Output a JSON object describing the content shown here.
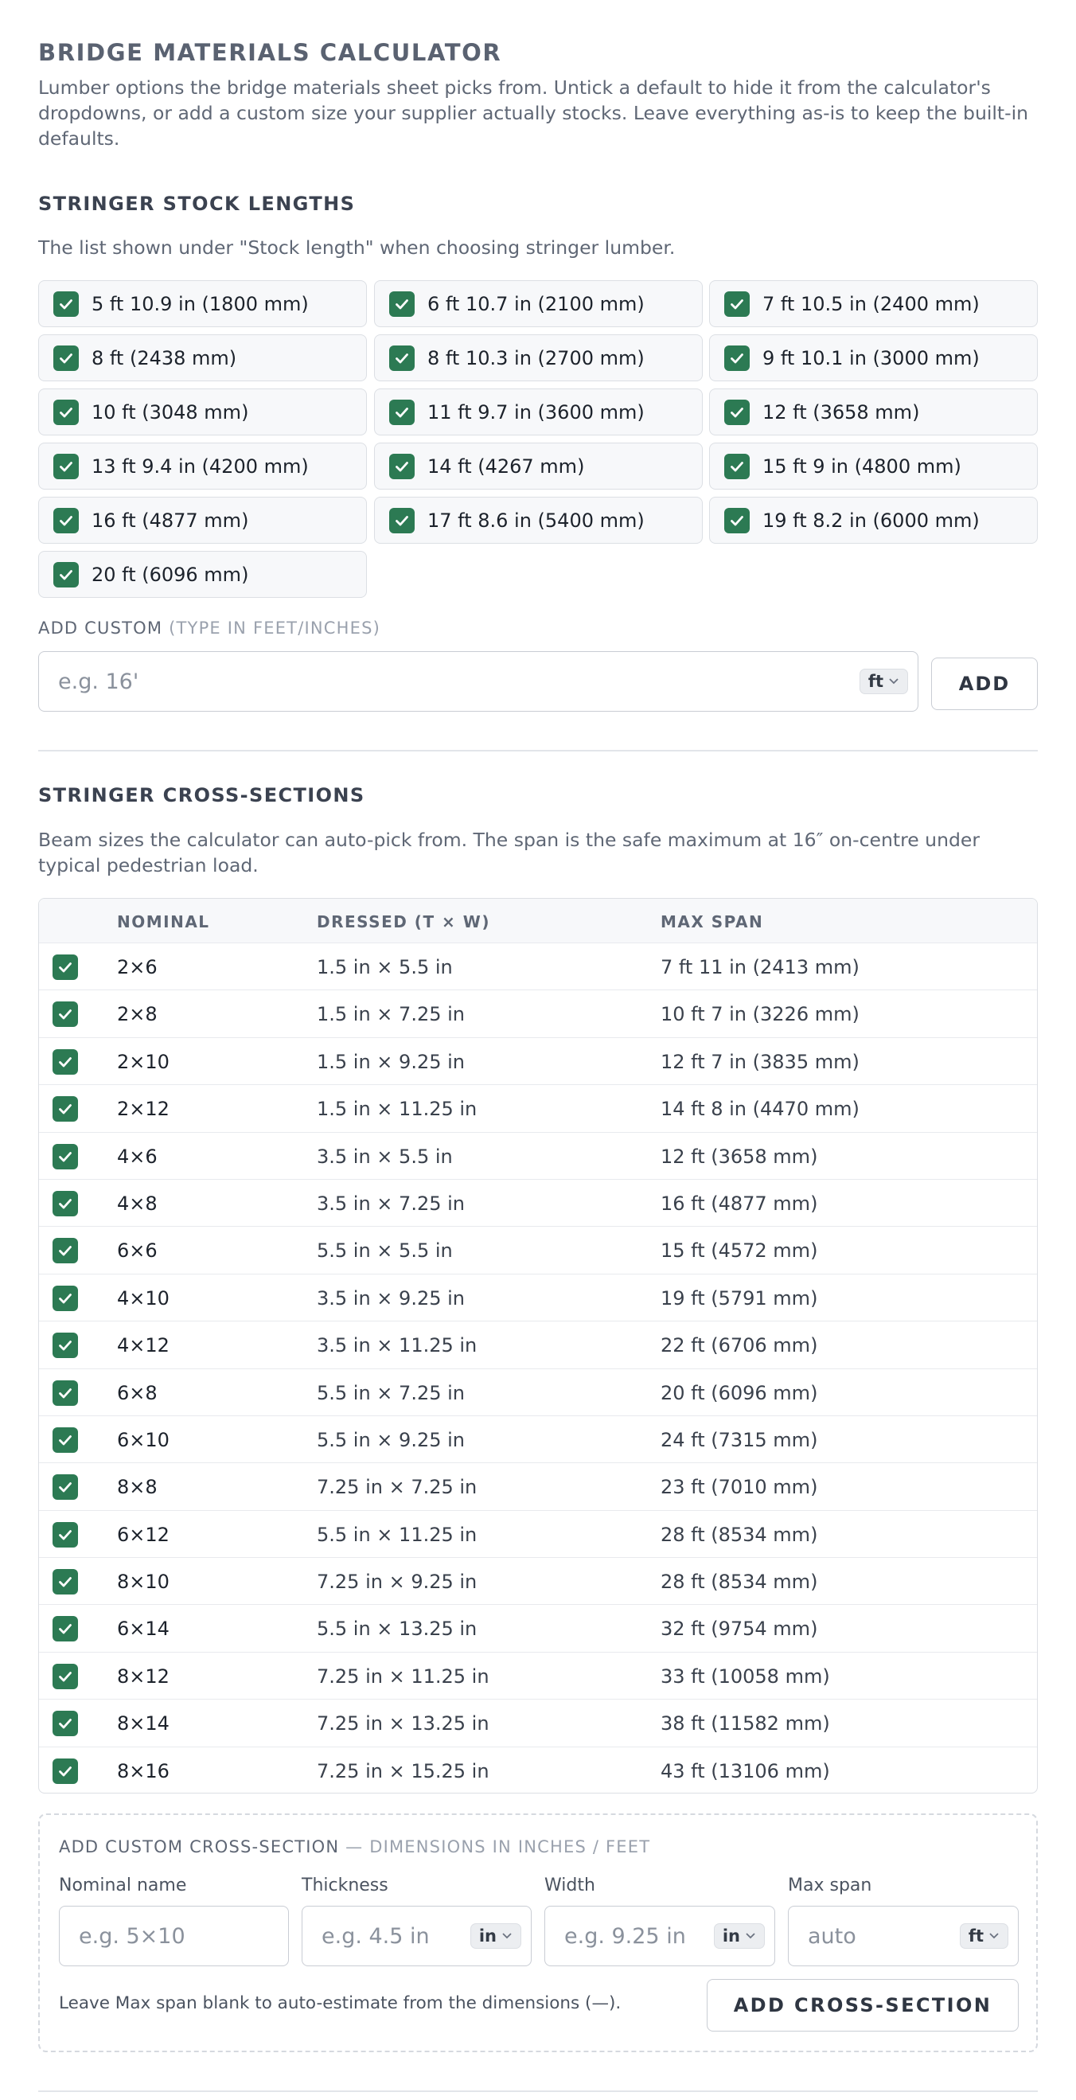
{
  "header": {
    "title": "BRIDGE MATERIALS CALCULATOR",
    "intro": "Lumber options the bridge materials sheet picks from. Untick a default to hide it from the calculator's dropdowns, or add a custom size your supplier actually stocks. Leave everything as-is to keep the built-in defaults."
  },
  "stock_lengths": {
    "title": "STRINGER STOCK LENGTHS",
    "description": "The list shown under \"Stock length\" when choosing stringer lumber.",
    "items": [
      {
        "label": "5 ft 10.9 in (1800 mm)",
        "checked": true
      },
      {
        "label": "6 ft 10.7 in (2100 mm)",
        "checked": true
      },
      {
        "label": "7 ft 10.5 in (2400 mm)",
        "checked": true
      },
      {
        "label": "8 ft (2438 mm)",
        "checked": true
      },
      {
        "label": "8 ft 10.3 in (2700 mm)",
        "checked": true
      },
      {
        "label": "9 ft 10.1 in (3000 mm)",
        "checked": true
      },
      {
        "label": "10 ft (3048 mm)",
        "checked": true
      },
      {
        "label": "11 ft 9.7 in (3600 mm)",
        "checked": true
      },
      {
        "label": "12 ft (3658 mm)",
        "checked": true
      },
      {
        "label": "13 ft 9.4 in (4200 mm)",
        "checked": true
      },
      {
        "label": "14 ft (4267 mm)",
        "checked": true
      },
      {
        "label": "15 ft 9 in (4800 mm)",
        "checked": true
      },
      {
        "label": "16 ft (4877 mm)",
        "checked": true
      },
      {
        "label": "17 ft 8.6 in (5400 mm)",
        "checked": true
      },
      {
        "label": "19 ft 8.2 in (6000 mm)",
        "checked": true
      },
      {
        "label": "20 ft (6096 mm)",
        "checked": true
      }
    ],
    "add_custom_label": "ADD CUSTOM",
    "add_custom_hint": "(TYPE IN FEET/INCHES)",
    "input_placeholder": "e.g. 16'",
    "unit": "ft",
    "add_button": "ADD"
  },
  "cross_sections": {
    "title": "STRINGER CROSS-SECTIONS",
    "description": "Beam sizes the calculator can auto-pick from. The span is the safe maximum at 16″ on-centre under typical pedestrian load.",
    "columns": {
      "nominal": "NOMINAL",
      "dressed": "DRESSED (T × W)",
      "span": "MAX SPAN"
    },
    "rows": [
      {
        "nominal": "2×6",
        "dressed": "1.5 in × 5.5 in",
        "span": "7 ft 11 in (2413 mm)",
        "checked": true
      },
      {
        "nominal": "2×8",
        "dressed": "1.5 in × 7.25 in",
        "span": "10 ft 7 in (3226 mm)",
        "checked": true
      },
      {
        "nominal": "2×10",
        "dressed": "1.5 in × 9.25 in",
        "span": "12 ft 7 in (3835 mm)",
        "checked": true
      },
      {
        "nominal": "2×12",
        "dressed": "1.5 in × 11.25 in",
        "span": "14 ft 8 in (4470 mm)",
        "checked": true
      },
      {
        "nominal": "4×6",
        "dressed": "3.5 in × 5.5 in",
        "span": "12 ft (3658 mm)",
        "checked": true
      },
      {
        "nominal": "4×8",
        "dressed": "3.5 in × 7.25 in",
        "span": "16 ft (4877 mm)",
        "checked": true
      },
      {
        "nominal": "6×6",
        "dressed": "5.5 in × 5.5 in",
        "span": "15 ft (4572 mm)",
        "checked": true
      },
      {
        "nominal": "4×10",
        "dressed": "3.5 in × 9.25 in",
        "span": "19 ft (5791 mm)",
        "checked": true
      },
      {
        "nominal": "4×12",
        "dressed": "3.5 in × 11.25 in",
        "span": "22 ft (6706 mm)",
        "checked": true
      },
      {
        "nominal": "6×8",
        "dressed": "5.5 in × 7.25 in",
        "span": "20 ft (6096 mm)",
        "checked": true
      },
      {
        "nominal": "6×10",
        "dressed": "5.5 in × 9.25 in",
        "span": "24 ft (7315 mm)",
        "checked": true
      },
      {
        "nominal": "8×8",
        "dressed": "7.25 in × 7.25 in",
        "span": "23 ft (7010 mm)",
        "checked": true
      },
      {
        "nominal": "6×12",
        "dressed": "5.5 in × 11.25 in",
        "span": "28 ft (8534 mm)",
        "checked": true
      },
      {
        "nominal": "8×10",
        "dressed": "7.25 in × 9.25 in",
        "span": "28 ft (8534 mm)",
        "checked": true
      },
      {
        "nominal": "6×14",
        "dressed": "5.5 in × 13.25 in",
        "span": "32 ft (9754 mm)",
        "checked": true
      },
      {
        "nominal": "8×12",
        "dressed": "7.25 in × 11.25 in",
        "span": "33 ft (10058 mm)",
        "checked": true
      },
      {
        "nominal": "8×14",
        "dressed": "7.25 in × 13.25 in",
        "span": "38 ft (11582 mm)",
        "checked": true
      },
      {
        "nominal": "8×16",
        "dressed": "7.25 in × 15.25 in",
        "span": "43 ft (13106 mm)",
        "checked": true
      }
    ]
  },
  "custom_cross_section": {
    "heading": "ADD CUSTOM CROSS-SECTION",
    "heading_hint": "— DIMENSIONS IN INCHES / FEET",
    "fields": {
      "nominal": {
        "label": "Nominal name",
        "placeholder": "e.g. 5×10"
      },
      "thickness": {
        "label": "Thickness",
        "placeholder": "e.g. 4.5 in",
        "unit": "in"
      },
      "width": {
        "label": "Width",
        "placeholder": "e.g. 9.25 in",
        "unit": "in"
      },
      "max_span": {
        "label": "Max span",
        "placeholder": "auto",
        "unit": "ft"
      }
    },
    "note": "Leave Max span blank to auto-estimate from the dimensions (—).",
    "add_button": "ADD CROSS-SECTION"
  },
  "colors": {
    "checkbox": "#2c7a53",
    "border": "#dcdfe4"
  }
}
